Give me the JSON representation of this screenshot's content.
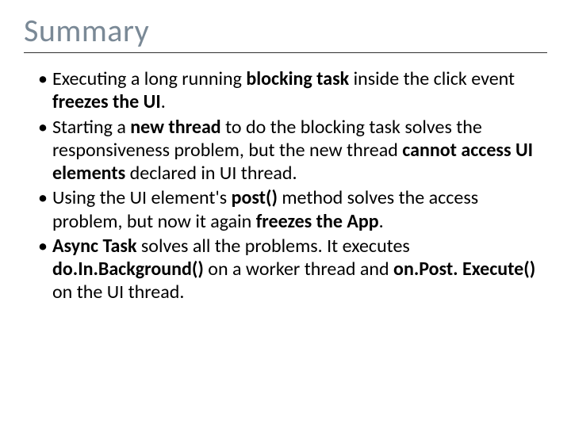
{
  "title": "Summary",
  "bullets": [
    {
      "runs": [
        {
          "t": "Executing a long running ",
          "b": false
        },
        {
          "t": "blocking task",
          "b": true
        },
        {
          "t": " inside the click event ",
          "b": false
        },
        {
          "t": "freezes the UI",
          "b": true
        },
        {
          "t": ".",
          "b": false
        }
      ]
    },
    {
      "runs": [
        {
          "t": "Starting a ",
          "b": false
        },
        {
          "t": "new thread",
          "b": true
        },
        {
          "t": " to do the blocking task solves the responsiveness problem, but the new thread ",
          "b": false
        },
        {
          "t": "cannot access UI elements",
          "b": true
        },
        {
          "t": " declared in UI thread.",
          "b": false
        }
      ]
    },
    {
      "runs": [
        {
          "t": "Using the UI element's ",
          "b": false
        },
        {
          "t": "post()",
          "b": true
        },
        {
          "t": " method solves the access problem, but now it again ",
          "b": false
        },
        {
          "t": "freezes the App",
          "b": true
        },
        {
          "t": ".",
          "b": false
        }
      ]
    },
    {
      "runs": [
        {
          "t": "Async Task",
          "b": true
        },
        {
          "t": " solves all the problems. It executes ",
          "b": false
        },
        {
          "t": "do.In.Background()",
          "b": true
        },
        {
          "t": " on a worker thread and ",
          "b": false
        },
        {
          "t": "on.Post. Execute()",
          "b": true
        },
        {
          "t": " on the UI thread.",
          "b": false
        }
      ]
    }
  ]
}
